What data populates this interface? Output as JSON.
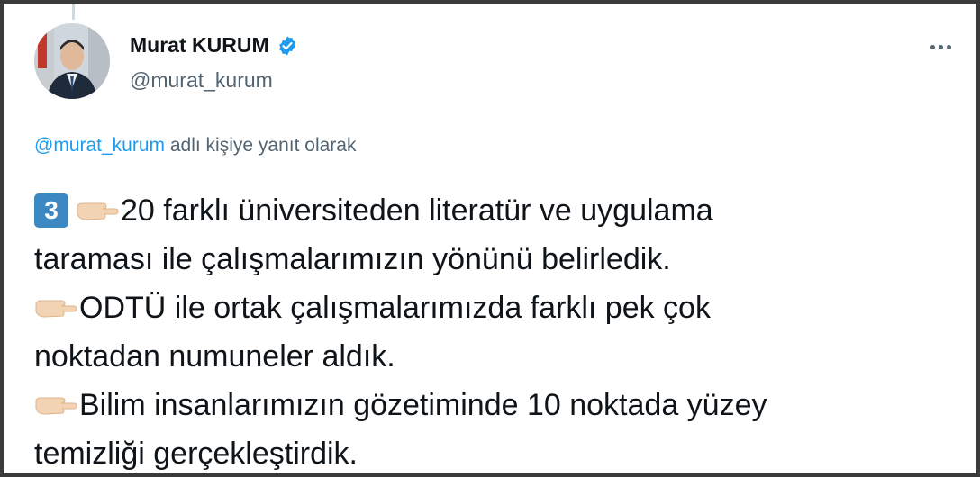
{
  "tweet": {
    "author_name": "Murat KURUM",
    "handle": "@murat_kurum",
    "reply_mention": "@murat_kurum",
    "reply_suffix": " adlı kişiye yanıt olarak",
    "keycap_number": "3",
    "lines": [
      "20 farklı üniversiteden literatür ve uygulama",
      "taraması ile çalışmalarımızın yönünü belirledik.",
      "ODTÜ ile ortak çalışmalarımızda farklı pek çok",
      "noktadan numuneler aldık.",
      "Bilim insanlarımızın gözetiminde 10 noktada yüzey",
      "temizliği gerçekleştirdik."
    ],
    "icons": {
      "verified": "verified-badge-icon",
      "more": "more-options-icon",
      "keycap": "keycap-3-emoji",
      "pointing": "backhand-index-pointing-right-emoji"
    },
    "colors": {
      "accent": "#1d9bf0",
      "text": "#0f1419",
      "muted": "#536471",
      "keycap": "#3b88c3"
    }
  }
}
